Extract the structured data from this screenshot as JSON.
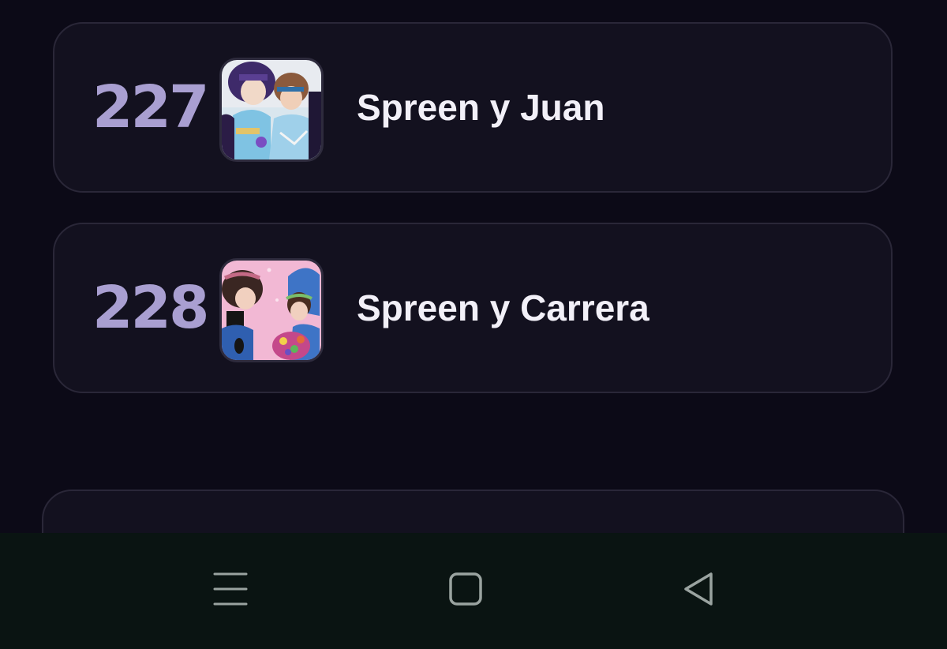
{
  "items": [
    {
      "rank": "227",
      "title": "Spreen y Juan",
      "thumbnail": "artwork-spreen-y-juan"
    },
    {
      "rank": "228",
      "title": "Spreen y Carrera",
      "thumbnail": "artwork-spreen-y-carrera"
    }
  ],
  "navbar": {
    "buttons": [
      {
        "icon": "menu-icon"
      },
      {
        "icon": "home-icon"
      },
      {
        "icon": "back-icon"
      }
    ]
  },
  "colors": {
    "background": "#0c0a17",
    "card": "#13111f",
    "card_border": "#2a2738",
    "rank": "#a99fd1",
    "title": "#f2f0f8",
    "navbar": "#0a1412",
    "nav_icon": "#9aa3a0"
  }
}
